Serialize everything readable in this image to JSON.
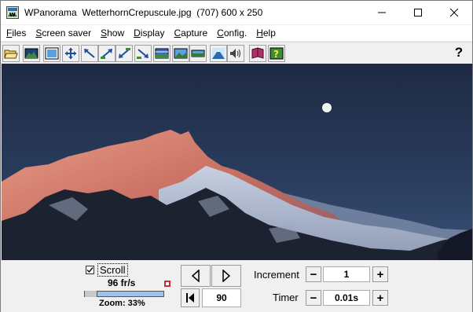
{
  "window": {
    "title": "WPanorama  WetterhornCrepuscule.jpg  (707) 600 x 250"
  },
  "menu": {
    "items": [
      {
        "label": "Files",
        "accel": "F"
      },
      {
        "label": "Screen saver",
        "accel": "S"
      },
      {
        "label": "Show",
        "accel": "S"
      },
      {
        "label": "Display",
        "accel": "D"
      },
      {
        "label": "Capture",
        "accel": "C"
      },
      {
        "label": "Config.",
        "accel": "C"
      },
      {
        "label": "Help",
        "accel": "H"
      }
    ]
  },
  "toolbar": {
    "help_label": "?"
  },
  "controls": {
    "scroll_label": "Scroll",
    "scroll_checked": true,
    "fps": "96 fr/s",
    "zoom": "Zoom: 33%",
    "zoom_percent": 33,
    "frame_value": "90",
    "increment_label": "Increment",
    "increment_value": "1",
    "timer_label": "Timer",
    "timer_value": "0.01s",
    "minus": "−",
    "plus": "+"
  }
}
